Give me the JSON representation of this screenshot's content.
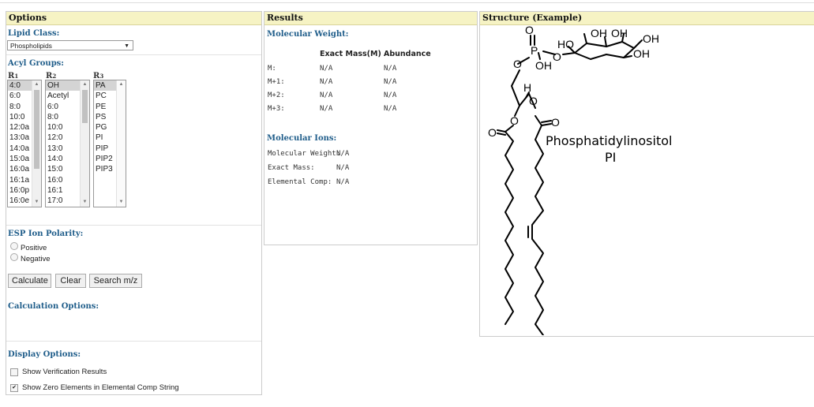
{
  "options": {
    "header": "Options",
    "lipid_class_label": "Lipid Class:",
    "lipid_class_value": "Phospholipids",
    "acyl_groups_label": "Acyl Groups:",
    "r1_label": "R1",
    "r2_label": "R2",
    "r3_label": "R3",
    "r1_items": [
      "4:0",
      "6:0",
      "8:0",
      "10:0",
      "12:0a",
      "13:0a",
      "14:0a",
      "15:0a",
      "16:0a",
      "16:1a",
      "16:0p",
      "16:0e"
    ],
    "r2_items": [
      "OH",
      "Acetyl",
      "6:0",
      "8:0",
      "10:0",
      "12:0",
      "13:0",
      "14:0",
      "15:0",
      "16:0",
      "16:1",
      "17:0"
    ],
    "r3_items": [
      "PA",
      "PC",
      "PE",
      "PS",
      "PG",
      "PI",
      "PIP",
      "PIP2",
      "PIP3"
    ],
    "esp_label": "ESP Ion Polarity:",
    "positive_label": "Positive",
    "negative_label": "Negative",
    "calculate_label": "Calculate",
    "clear_label": "Clear",
    "search_label": "Search m/z",
    "calc_options_label": "Calculation Options:",
    "display_options_label": "Display Options:",
    "show_verification_label": "Show Verification Results",
    "show_zero_label": "Show Zero Elements in Elemental Comp String"
  },
  "results": {
    "header": "Results",
    "mw_label": "Molecular Weight:",
    "col_exact": "Exact Mass(M)",
    "col_abundance": "Abundance",
    "rows": [
      {
        "label": "M:",
        "exact": "N/A",
        "abund": "N/A"
      },
      {
        "label": "M+1:",
        "exact": "N/A",
        "abund": "N/A"
      },
      {
        "label": "M+2:",
        "exact": "N/A",
        "abund": "N/A"
      },
      {
        "label": "M+3:",
        "exact": "N/A",
        "abund": "N/A"
      }
    ],
    "ions_label": "Molecular Ions:",
    "ion_rows": [
      {
        "label": "Molecular Weight:",
        "value": "N/A"
      },
      {
        "label": "Exact Mass:",
        "value": "N/A"
      },
      {
        "label": "Elemental Comp:",
        "value": "N/A"
      }
    ]
  },
  "structure": {
    "header": "Structure (Example)",
    "name": "Phosphatidylinositol",
    "abbr": "PI",
    "atoms": {
      "o": "O",
      "p": "P",
      "oh": "OH",
      "ho": "HO",
      "h": "H"
    }
  },
  "colors": {
    "header_bg": "#f6f3c4",
    "section_blue": "#1f5d8a",
    "selected": "#d4d4d4"
  }
}
